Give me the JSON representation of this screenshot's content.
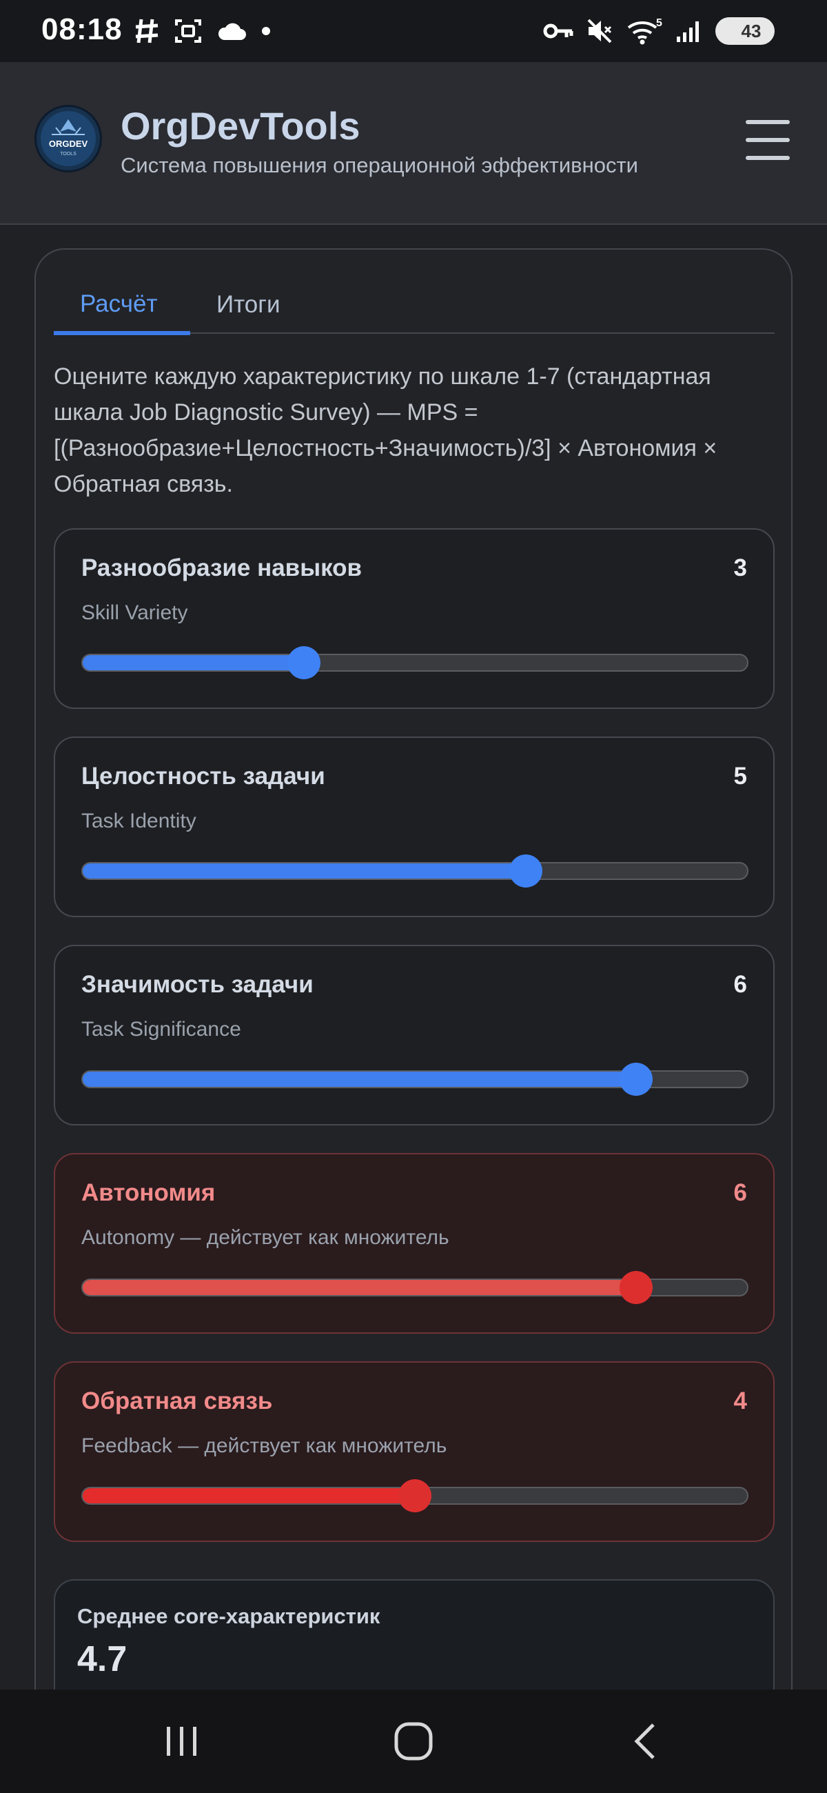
{
  "status_bar": {
    "time": "08:18",
    "battery": "43",
    "wifi_badge": "5"
  },
  "header": {
    "title": "OrgDevTools",
    "subtitle": "Система повышения операционной эффективности",
    "logo_text": "ORGDEV",
    "logo_subtext": "TOOLS"
  },
  "tabs": [
    {
      "label": "Расчёт",
      "active": true
    },
    {
      "label": "Итоги",
      "active": false
    }
  ],
  "intro": "Оцените каждую характеристику по шкале 1-7 (стандартная шкала Job Diagnostic Survey) — MPS = [(Разнообразие+Целостность+Значимость)/3] × Автономия × Обратная связь.",
  "scale": {
    "min": 1,
    "max": 7
  },
  "sliders": [
    {
      "label": "Разнообразие навыков",
      "sub": "Skill Variety",
      "value": "3"
    },
    {
      "label": "Целостность задачи",
      "sub": "Task Identity",
      "value": "5"
    },
    {
      "label": "Значимость задачи",
      "sub": "Task Significance",
      "value": "6"
    },
    {
      "label": "Автономия",
      "sub": "Autonomy — действует как множитель",
      "value": "6"
    },
    {
      "label": "Обратная связь",
      "sub": "Feedback — действует как множитель",
      "value": "4"
    }
  ],
  "summary": {
    "label": "Среднее core-характеристик",
    "value": "4.7"
  },
  "colors": {
    "accent_blue": "#3f7ff0",
    "multiplier_red": "#de2f2f",
    "background": "#202124"
  }
}
